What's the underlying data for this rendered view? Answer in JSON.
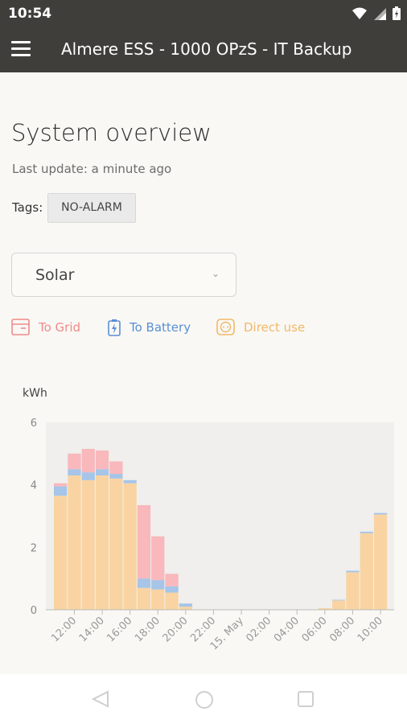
{
  "status": {
    "time": "10:54"
  },
  "appbar": {
    "title": "Almere ESS - 1000 OPzS - IT Backup"
  },
  "overview": {
    "heading": "System overview",
    "last_update": "Last update: a minute ago",
    "tags_label": "Tags:",
    "tag": "NO-ALARM"
  },
  "select": {
    "value": "Solar",
    "chevron": "⌄"
  },
  "legend": [
    {
      "label": "To Grid",
      "color": "#ef8a8a",
      "icon": "grid-icon"
    },
    {
      "label": "To Battery",
      "color": "#5b8fd6",
      "icon": "battery-icon"
    },
    {
      "label": "Direct use",
      "color": "#f2b869",
      "icon": "socket-icon"
    }
  ],
  "chart_data": {
    "type": "bar",
    "ylabel": "kWh",
    "ylim": [
      0,
      6
    ],
    "yticks": [
      "0",
      "2",
      "4",
      "6"
    ],
    "xticks": [
      "12:00",
      "14:00",
      "16:00",
      "18:00",
      "20:00",
      "22:00",
      "15. May",
      "02:00",
      "04:00",
      "06:00",
      "08:00",
      "10:00"
    ],
    "hours": [
      "11",
      "12",
      "13",
      "14",
      "15",
      "16",
      "17",
      "18",
      "19",
      "20",
      "21",
      "22",
      "23",
      "0",
      "1",
      "2",
      "3",
      "4",
      "5",
      "6",
      "7",
      "8",
      "9",
      "10"
    ],
    "series": [
      {
        "name": "Direct use",
        "color": "#f9d4a2",
        "values": [
          3.65,
          4.3,
          4.15,
          4.3,
          4.2,
          4.05,
          0.7,
          0.65,
          0.55,
          0.1,
          0,
          0,
          0,
          0,
          0,
          0,
          0,
          0,
          0,
          0.05,
          0.3,
          1.2,
          2.45,
          3.05
        ]
      },
      {
        "name": "To Battery",
        "color": "#a6c5e8",
        "values": [
          0.3,
          0.2,
          0.25,
          0.2,
          0.15,
          0.1,
          0.3,
          0.3,
          0.2,
          0.1,
          0,
          0,
          0,
          0,
          0,
          0,
          0,
          0,
          0,
          0,
          0.02,
          0.05,
          0.05,
          0.05
        ]
      },
      {
        "name": "To Grid",
        "color": "#f8b8bc",
        "values": [
          0.1,
          0.5,
          0.75,
          0.6,
          0.4,
          0,
          2.35,
          1.4,
          0.4,
          0,
          0,
          0,
          0,
          0,
          0,
          0,
          0,
          0,
          0,
          0,
          0,
          0,
          0,
          0
        ]
      }
    ]
  }
}
